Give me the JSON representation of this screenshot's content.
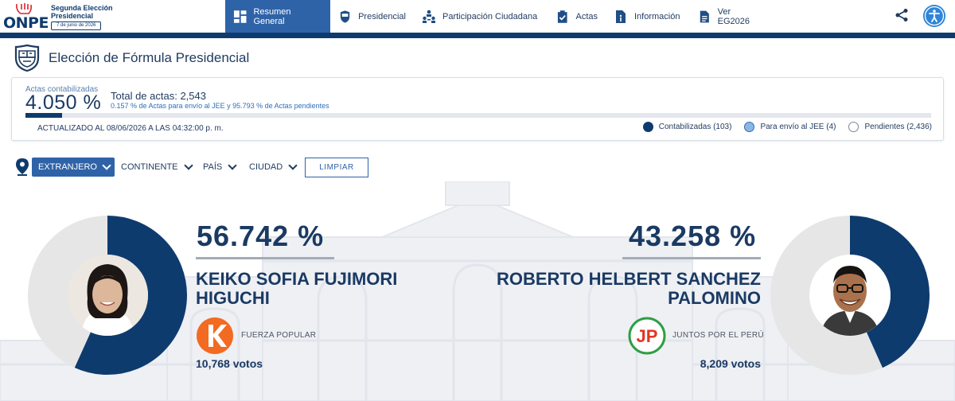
{
  "header": {
    "logo_text": "ONPE",
    "logo_title": "Segunda Elección Presidencial",
    "logo_date": "7 de junio de 2026",
    "nav": [
      {
        "label": "Resumen General",
        "icon": "dashboard-icon",
        "active": true
      },
      {
        "label": "Presidencial",
        "icon": "coat-of-arms-icon",
        "active": false
      },
      {
        "label": "Participación Ciudadana",
        "icon": "people-icon",
        "active": false
      },
      {
        "label": "Actas",
        "icon": "clipboard-check-icon",
        "active": false
      },
      {
        "label": "Información",
        "icon": "info-document-icon",
        "active": false
      },
      {
        "label": "Ver EG2026",
        "icon": "document-icon",
        "active": false
      }
    ]
  },
  "page": {
    "title": "Elección de Fórmula Presidencial"
  },
  "progress": {
    "label": "Actas contabilizadas",
    "percent": "4.050 %",
    "percent_value": 4.05,
    "total": "Total de actas: 2,543",
    "subtitle": "0.157 % de Actas para envío al JEE y 95.793 % de Actas pendientes",
    "updated": "ACTUALIZADO AL 08/06/2026 A LAS 04:32:00 p. m.",
    "legend": [
      {
        "label": "Contabilizadas (103)",
        "color": "#0e3b6e"
      },
      {
        "label": "Para envío al JEE (4)",
        "color": "#8cb7e3"
      },
      {
        "label": "Pendientes (2,436)",
        "color": "#ffffff"
      }
    ]
  },
  "filters": {
    "scope": "EXTRANJERO",
    "continent": "CONTINENTE",
    "country": "PAÍS",
    "city": "CIUDAD",
    "clear": "LIMPIAR"
  },
  "candidates": [
    {
      "percent": "56.742 %",
      "share": 0.56742,
      "name_line1": "KEIKO SOFIA FUJIMORI",
      "name_line2": "HIGUCHI",
      "party": "FUERZA POPULAR",
      "votes": "10,768 votos",
      "party_letter": "K",
      "party_color": "#f26b21"
    },
    {
      "percent": "43.258 %",
      "share": 0.43258,
      "name_line1": "ROBERTO HELBERT SANCHEZ",
      "name_line2": "PALOMINO",
      "party": "JUNTOS POR EL PERÚ",
      "votes": "8,209 votos",
      "party_letter": "JP",
      "party_color": "#e63323"
    }
  ],
  "colors": {
    "primary": "#0e3b6e",
    "accent": "#2f63a8",
    "donut_rest": "#e6e6e6"
  }
}
